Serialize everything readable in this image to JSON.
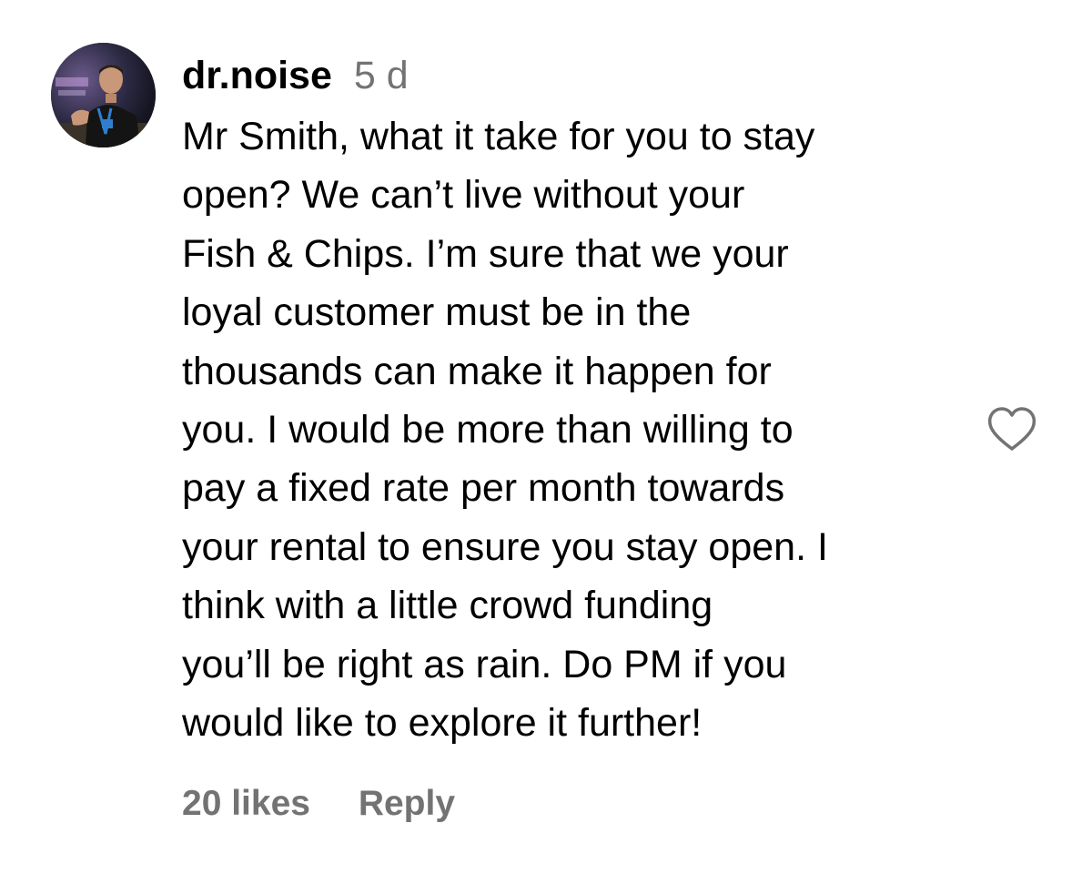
{
  "comment": {
    "username": "dr.noise",
    "timestamp": "5 d",
    "text_lines": [
      "Mr Smith, what it take for you to stay",
      "open? We can’t live without your",
      "Fish & Chips. I’m sure that we your",
      "loyal customer must be in the",
      "thousands can make it happen for",
      "you. I would be more than willing to",
      "pay a fixed rate per month towards",
      "your rental to ensure you stay open. I",
      "think with a little crowd funding",
      "you’ll be right as rain. Do PM if you",
      "would like to explore it further!"
    ],
    "likes_label": "20 likes",
    "reply_label": "Reply",
    "like_icon": "heart-outline-icon"
  },
  "colors": {
    "text": "#000000",
    "secondary_text": "#737373",
    "background": "#ffffff"
  }
}
